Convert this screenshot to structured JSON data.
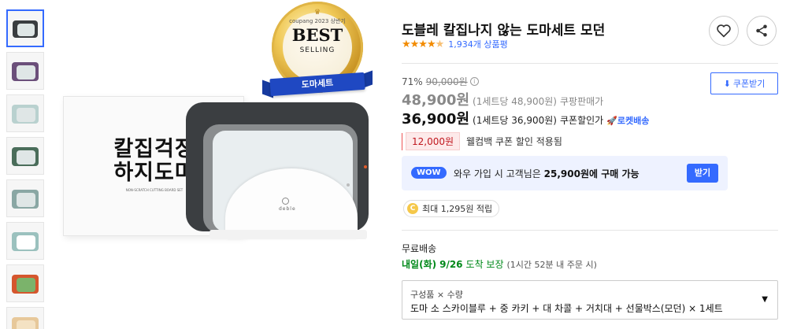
{
  "thumbnails": {
    "count": 8,
    "active_index": 0
  },
  "main_image": {
    "box_text_line1": "칼집걱정",
    "box_text_line2": "하지도마",
    "box_subtext": "NON-SCRATCH CUTTING BOARD SET",
    "brand_logo": "deble",
    "badge": {
      "top_text": "coupang 2023 상반기",
      "main_text": "BEST",
      "sub_text": "SELLING",
      "ribbon_text": "도마세트"
    }
  },
  "product": {
    "title": "도블레 칼집나지 않는 도마세트 모던",
    "rating_stars": 4.5,
    "review_count": "1,934개 상품평",
    "discount_rate": "71%",
    "original_price": "90,000원",
    "sale_price": "48,900원",
    "sale_unit": "(1세트당 48,900원)",
    "sale_label": "쿠팡판매가",
    "coupon_price": "36,900원",
    "coupon_unit": "(1세트당 36,900원)",
    "coupon_label": "쿠폰할인가",
    "rocket_label": "로켓배송",
    "coupon_button": "쿠폰받기",
    "welcome_amount": "12,000원",
    "welcome_text": "웰컴백 쿠폰 할인 적용됨"
  },
  "wow": {
    "badge": "WOW",
    "text_prefix": "와우 가입 시 고객님은",
    "text_price": "25,900원에 구매 가능",
    "button": "받기"
  },
  "reward": {
    "coin": "C",
    "text": "최대 1,295원 적립"
  },
  "shipping": {
    "title": "무료배송",
    "day": "내일(화)",
    "date": "9/26",
    "guarantee": "도착 보장",
    "note": "(1시간 52분 내 주문 시)"
  },
  "option": {
    "label": "구성품 × 수량",
    "value": "도마 소 스카이블루 + 중 카키 + 대 차콜 + 거치대 + 선물박스(모던) × 1세트"
  },
  "icons": [
    "heart-icon",
    "share-icon",
    "download-icon",
    "info-icon",
    "rocket-icon",
    "chevron-down-icon"
  ]
}
